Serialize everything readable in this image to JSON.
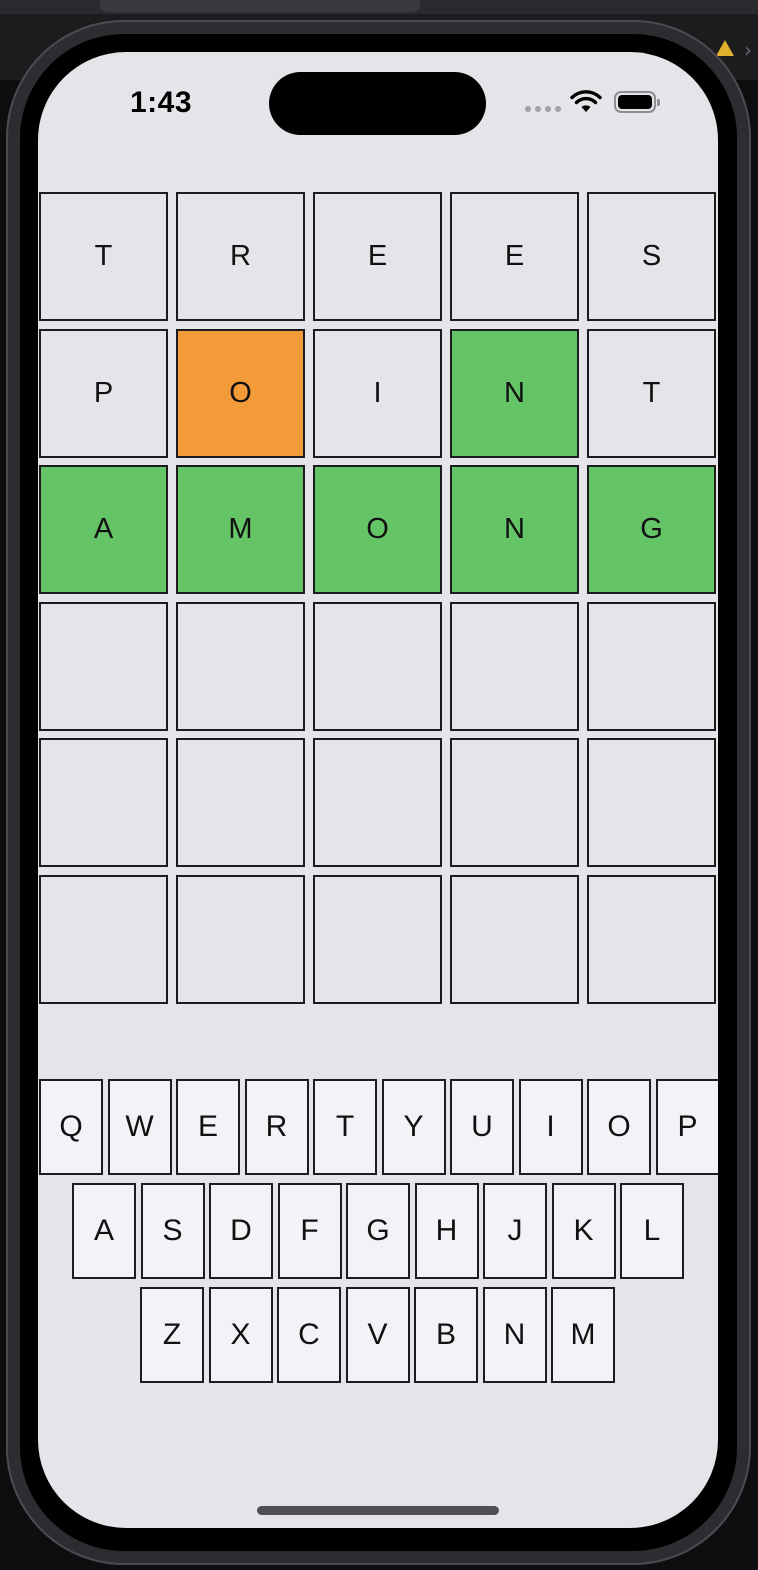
{
  "status_bar": {
    "time": "1:43"
  },
  "board": {
    "rows": [
      [
        {
          "letter": "T",
          "state": "empty"
        },
        {
          "letter": "R",
          "state": "empty"
        },
        {
          "letter": "E",
          "state": "empty"
        },
        {
          "letter": "E",
          "state": "empty"
        },
        {
          "letter": "S",
          "state": "empty"
        }
      ],
      [
        {
          "letter": "P",
          "state": "empty"
        },
        {
          "letter": "O",
          "state": "present"
        },
        {
          "letter": "I",
          "state": "empty"
        },
        {
          "letter": "N",
          "state": "correct"
        },
        {
          "letter": "T",
          "state": "empty"
        }
      ],
      [
        {
          "letter": "A",
          "state": "correct"
        },
        {
          "letter": "M",
          "state": "correct"
        },
        {
          "letter": "O",
          "state": "correct"
        },
        {
          "letter": "N",
          "state": "correct"
        },
        {
          "letter": "G",
          "state": "correct"
        }
      ],
      [
        {
          "letter": "",
          "state": "empty"
        },
        {
          "letter": "",
          "state": "empty"
        },
        {
          "letter": "",
          "state": "empty"
        },
        {
          "letter": "",
          "state": "empty"
        },
        {
          "letter": "",
          "state": "empty"
        }
      ],
      [
        {
          "letter": "",
          "state": "empty"
        },
        {
          "letter": "",
          "state": "empty"
        },
        {
          "letter": "",
          "state": "empty"
        },
        {
          "letter": "",
          "state": "empty"
        },
        {
          "letter": "",
          "state": "empty"
        }
      ],
      [
        {
          "letter": "",
          "state": "empty"
        },
        {
          "letter": "",
          "state": "empty"
        },
        {
          "letter": "",
          "state": "empty"
        },
        {
          "letter": "",
          "state": "empty"
        },
        {
          "letter": "",
          "state": "empty"
        }
      ]
    ]
  },
  "keyboard": {
    "rows": [
      [
        "Q",
        "W",
        "E",
        "R",
        "T",
        "Y",
        "U",
        "I",
        "O",
        "P"
      ],
      [
        "A",
        "S",
        "D",
        "F",
        "G",
        "H",
        "J",
        "K",
        "L"
      ],
      [
        "Z",
        "X",
        "C",
        "V",
        "B",
        "N",
        "M"
      ]
    ]
  },
  "colors": {
    "present": "#f29b38",
    "correct": "#65c466",
    "empty": "#e4e4e9",
    "key": "#f2f2f7",
    "background": "#e4e4e9"
  },
  "icons": {
    "wifi": "wifi-icon",
    "battery": "battery-icon",
    "signal": "cellular-signal-icon",
    "warning": "warning-icon"
  }
}
